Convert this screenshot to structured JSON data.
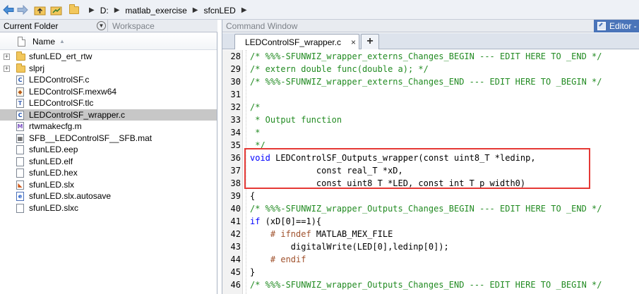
{
  "address_bar": {
    "path": [
      "D:",
      "matlab_exercise",
      "sfcnLED"
    ]
  },
  "current_folder": {
    "tabs": [
      "Current Folder",
      "Workspace"
    ],
    "column_header": "Name",
    "sort_indicator": "ascending",
    "files": [
      {
        "name": "sfunLED_ert_rtw",
        "type": "folder",
        "expandable": true,
        "selected": false
      },
      {
        "name": "slprj",
        "type": "folder",
        "expandable": true,
        "selected": false
      },
      {
        "name": "LEDControlSF.c",
        "type": "c",
        "expandable": false,
        "selected": false
      },
      {
        "name": "LEDControlSF.mexw64",
        "type": "mex",
        "expandable": false,
        "selected": false
      },
      {
        "name": "LEDControlSF.tlc",
        "type": "tlc",
        "expandable": false,
        "selected": false
      },
      {
        "name": "LEDControlSF_wrapper.c",
        "type": "c",
        "expandable": false,
        "selected": true
      },
      {
        "name": "rtwmakecfg.m",
        "type": "m",
        "expandable": false,
        "selected": false
      },
      {
        "name": "SFB__LEDControlSF__SFB.mat",
        "type": "mat",
        "expandable": false,
        "selected": false
      },
      {
        "name": "sfunLED.eep",
        "type": "blank",
        "expandable": false,
        "selected": false
      },
      {
        "name": "sfunLED.elf",
        "type": "blank",
        "expandable": false,
        "selected": false
      },
      {
        "name": "sfunLED.hex",
        "type": "blank",
        "expandable": false,
        "selected": false
      },
      {
        "name": "sfunLED.slx",
        "type": "slx",
        "expandable": false,
        "selected": false
      },
      {
        "name": "sfunLED.slx.autosave",
        "type": "auto",
        "expandable": false,
        "selected": false
      },
      {
        "name": "sfunLED.slxc",
        "type": "blank",
        "expandable": false,
        "selected": false
      }
    ]
  },
  "right_panel": {
    "command_window_tab": "Command Window",
    "editor_tab": "Editor -",
    "editor_file_tab": "LEDControlSF_wrapper.c",
    "new_tab_label": "+",
    "close_label": "×"
  },
  "code": {
    "highlighted_lines": [
      36,
      37,
      38
    ],
    "lines": [
      {
        "n": "28",
        "segments": [
          {
            "c": "comment",
            "t": "/* %%%-SFUNWIZ_wrapper_externs_Changes_BEGIN --- EDIT HERE TO _END */"
          }
        ]
      },
      {
        "n": "29",
        "segments": [
          {
            "c": "comment",
            "t": "/* extern double func(double a); */"
          }
        ]
      },
      {
        "n": "30",
        "segments": [
          {
            "c": "comment",
            "t": "/* %%%-SFUNWIZ_wrapper_externs_Changes_END --- EDIT HERE TO _BEGIN */"
          }
        ]
      },
      {
        "n": "31",
        "segments": []
      },
      {
        "n": "32",
        "segments": [
          {
            "c": "comment",
            "t": "/*"
          }
        ]
      },
      {
        "n": "33",
        "segments": [
          {
            "c": "comment",
            "t": " * Output function"
          }
        ]
      },
      {
        "n": "34",
        "segments": [
          {
            "c": "comment",
            "t": " *"
          }
        ]
      },
      {
        "n": "35",
        "segments": [
          {
            "c": "comment",
            "t": " */"
          }
        ]
      },
      {
        "n": "36",
        "segments": [
          {
            "c": "kw",
            "t": "void"
          },
          {
            "c": "plain",
            "t": " LEDControlSF_Outputs_wrapper(const uint8_T *ledinp,"
          }
        ]
      },
      {
        "n": "37",
        "segments": [
          {
            "c": "plain",
            "t": "             const real_T *xD,"
          }
        ]
      },
      {
        "n": "38",
        "segments": [
          {
            "c": "plain",
            "t": "             const uint8_T *LED, const int_T p_width0)"
          }
        ]
      },
      {
        "n": "39",
        "segments": [
          {
            "c": "plain",
            "t": "{"
          }
        ]
      },
      {
        "n": "40",
        "segments": [
          {
            "c": "comment",
            "t": "/* %%%-SFUNWIZ_wrapper_Outputs_Changes_BEGIN --- EDIT HERE TO _END */"
          }
        ]
      },
      {
        "n": "41",
        "segments": [
          {
            "c": "kw",
            "t": "if"
          },
          {
            "c": "plain",
            "t": " (xD[0]==1){"
          }
        ]
      },
      {
        "n": "42",
        "segments": [
          {
            "c": "pp",
            "t": "    # ifndef"
          },
          {
            "c": "plain",
            "t": " MATLAB_MEX_FILE"
          }
        ]
      },
      {
        "n": "43",
        "segments": [
          {
            "c": "plain",
            "t": "        digitalWrite(LED[0],ledinp[0]);"
          }
        ]
      },
      {
        "n": "44",
        "segments": [
          {
            "c": "pp",
            "t": "    # endif"
          }
        ]
      },
      {
        "n": "45",
        "segments": [
          {
            "c": "plain",
            "t": "}"
          }
        ]
      },
      {
        "n": "46",
        "segments": [
          {
            "c": "comment",
            "t": "/* %%%-SFUNWIZ_wrapper_Outputs_Changes_END --- EDIT HERE TO _BEGIN */"
          }
        ]
      }
    ]
  },
  "colors": {
    "comment": "#228b22",
    "keyword": "#0000ff",
    "preprocessor": "#a0522d",
    "highlight_box": "#e53935",
    "editor_tab": "#4a74b9",
    "selected_row": "#c7c7c7"
  }
}
